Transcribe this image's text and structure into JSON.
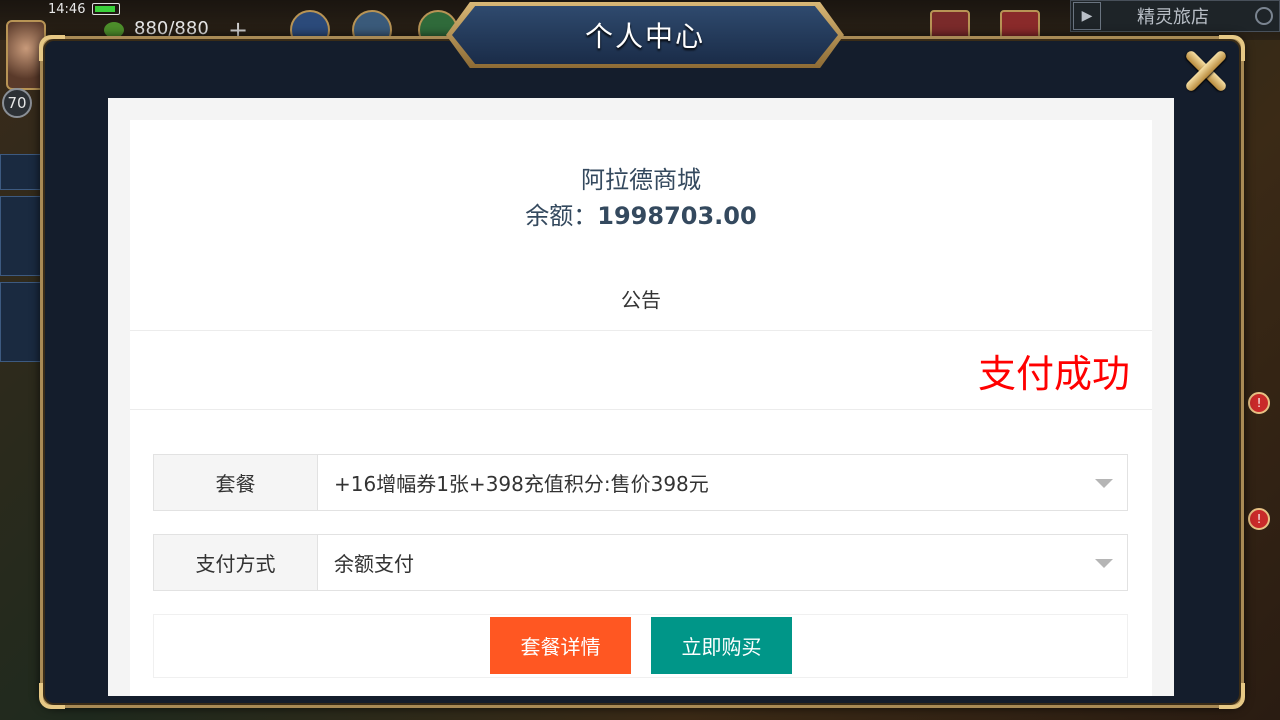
{
  "hud": {
    "time": "14:46",
    "energy": "880/880",
    "level": "70",
    "inn_label": "精灵旅店"
  },
  "modal": {
    "title": "个人中心"
  },
  "shop": {
    "name": "阿拉德商城",
    "balance_label": "余额：",
    "balance_value": "1998703.00",
    "notice_title": "公告",
    "pay_status": "支付成功"
  },
  "form": {
    "package_label": "套餐",
    "package_value": "+16增幅券1张+398充值积分:售价398元",
    "payment_label": "支付方式",
    "payment_value": "余额支付"
  },
  "buttons": {
    "detail": "套餐详情",
    "buy": "立即购买"
  },
  "colors": {
    "detail_button": "#ff5722",
    "buy_button": "#009688",
    "success_text": "#ff0000",
    "text_primary": "#34495e"
  }
}
